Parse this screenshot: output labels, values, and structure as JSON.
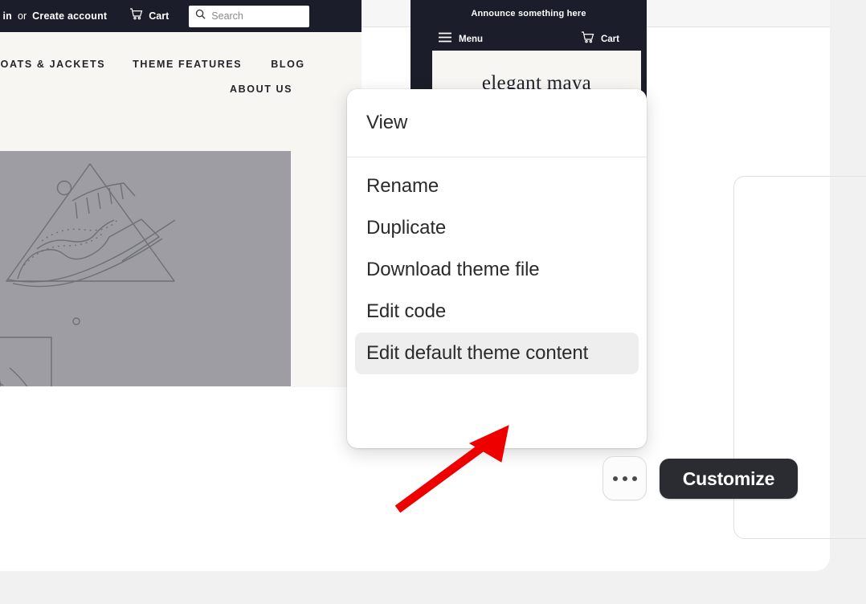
{
  "storefront_desktop": {
    "account_bar": {
      "login_text": "g in",
      "or_text": "or",
      "create_account_text": "Create account",
      "cart_label": "Cart",
      "cart_icon": "shopping-cart-icon",
      "search_icon": "search-icon",
      "search_placeholder": "Search",
      "search_value": ""
    },
    "nav_row1": [
      "COATS & JACKETS",
      "THEME FEATURES",
      "BLOG"
    ],
    "nav_row2": [
      "ABOUT US"
    ],
    "hero_image_alt": "placeholder-line-art-illustration"
  },
  "storefront_mobile": {
    "announcement": "Announce something here",
    "menu_label": "Menu",
    "menu_icon": "hamburger-menu-icon",
    "cart_label": "Cart",
    "cart_icon": "shopping-cart-icon",
    "logo_text": "elegant maya"
  },
  "popover_menu": {
    "groups": [
      {
        "items": [
          {
            "label": "View",
            "highlighted": false
          }
        ]
      },
      {
        "items": [
          {
            "label": "Rename",
            "highlighted": false
          },
          {
            "label": "Duplicate",
            "highlighted": false
          },
          {
            "label": "Download theme file",
            "highlighted": false
          },
          {
            "label": "Edit code",
            "highlighted": false
          },
          {
            "label": "Edit default theme content",
            "highlighted": true
          }
        ]
      }
    ]
  },
  "actions": {
    "more_button_label": "",
    "more_button_icon": "ellipsis-horizontal-icon",
    "customize_label": "Customize"
  },
  "annotation": {
    "arrow_color": "#ef0000",
    "arrow_points_to": "Edit default theme content"
  },
  "colors": {
    "storefront_dark": "#1b1e2a",
    "storefront_cream": "#f7f6f3",
    "page_background": "#f1f1f1",
    "card_background": "#ffffff",
    "highlight": "#eeeeee",
    "customize_button": "#2a2c32",
    "annotation_red": "#ef0000"
  }
}
